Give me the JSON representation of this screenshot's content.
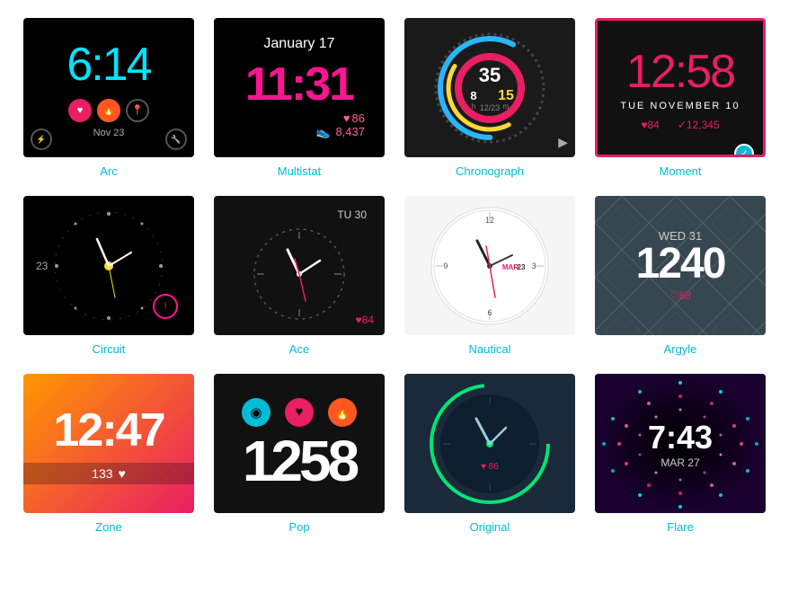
{
  "watches": [
    {
      "id": "arc",
      "label": "Arc",
      "time": "6:14",
      "date": "Nov 23"
    },
    {
      "id": "multistat",
      "label": "Multistat",
      "time": "11:31",
      "date": "January 17",
      "heart": "86",
      "steps": "8,437"
    },
    {
      "id": "chronograph",
      "label": "Chronograph",
      "bigNum": "35",
      "sub1": "8",
      "sub2": "15",
      "unit1": "h",
      "unit2": "m",
      "subdate": "12/23"
    },
    {
      "id": "moment",
      "label": "Moment",
      "time": "12:58",
      "date": "TUE NOVEMBER 10",
      "heart": "84",
      "steps": "12,345",
      "selected": true
    },
    {
      "id": "circuit",
      "label": "Circuit",
      "num": "23"
    },
    {
      "id": "ace",
      "label": "Ace",
      "date": "TU 30",
      "heart": "84"
    },
    {
      "id": "nautical",
      "label": "Nautical",
      "markerDate": "MAR 23"
    },
    {
      "id": "argyle",
      "label": "Argyle",
      "date": "WED 31",
      "time": "1240",
      "heart": "68"
    },
    {
      "id": "zone",
      "label": "Zone",
      "time": "12:47",
      "steps": "133"
    },
    {
      "id": "pop",
      "label": "Pop",
      "time": "1258"
    },
    {
      "id": "original",
      "label": "Original",
      "heart": "86"
    },
    {
      "id": "flare",
      "label": "Flare",
      "time": "7:43",
      "date": "MAR 27"
    }
  ]
}
